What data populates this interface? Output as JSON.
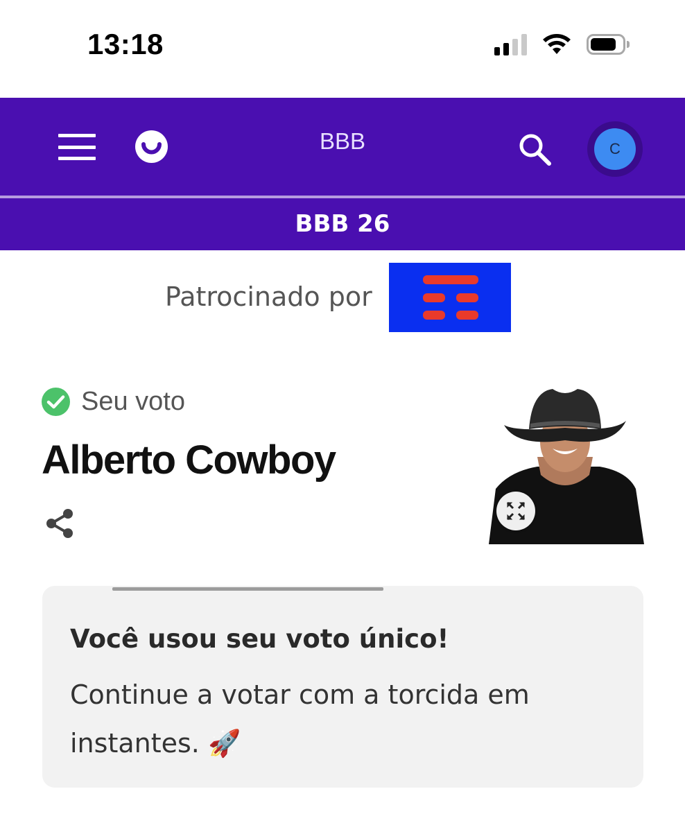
{
  "status_bar": {
    "time": "13:18",
    "icons": [
      "cellular-signal-icon",
      "wifi-icon",
      "battery-icon"
    ]
  },
  "header": {
    "title": "BBB",
    "menu_icon": "hamburger-menu-icon",
    "logo_icon": "smile-logo-icon",
    "search_icon": "search-icon",
    "avatar_initial": "C",
    "background_color": "#4a0fb0",
    "avatar_color": "#3d8bf2"
  },
  "subnav": {
    "label": "BBB 26"
  },
  "sponsor": {
    "label": "Patrocinado por",
    "logo_color": "#0a2ff0",
    "logo_mark_color": "#ea3a2a"
  },
  "vote": {
    "status_label": "Seu voto",
    "status_icon": "check-circle-icon",
    "status_color": "#4cc26a",
    "candidate_name": "Alberto Cowboy",
    "share_icon": "share-icon",
    "expand_icon": "expand-icon"
  },
  "info_card": {
    "title": "Você usou seu voto único!",
    "text": "Continue a votar com a torcida em instantes.",
    "emoji": "🚀"
  }
}
